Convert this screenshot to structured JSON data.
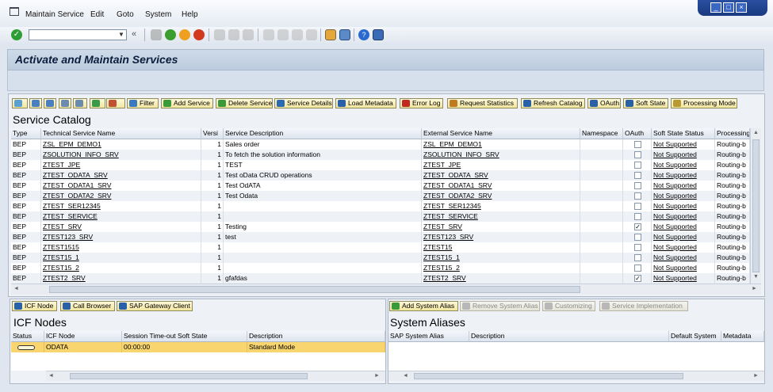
{
  "menubar": {
    "items": [
      "Maintain Service",
      "Edit",
      "Goto",
      "System",
      "Help"
    ]
  },
  "window_controls": {
    "minimize": "_",
    "restore": "□",
    "close": "×"
  },
  "toolbar": {
    "command_field": "",
    "back_icon": "«"
  },
  "page": {
    "title": "Activate and Maintain Services"
  },
  "catalog_toolbar": {
    "filter": "Filter",
    "add_service": "Add Service",
    "delete_service": "Delete Service",
    "service_details": "Service Details",
    "load_metadata": "Load Metadata",
    "error_log": "Error Log",
    "request_statistics": "Request Statistics",
    "refresh_catalog": "Refresh Catalog",
    "oauth": "OAuth",
    "soft_state": "Soft State",
    "processing_mode": "Processing Mode"
  },
  "catalog": {
    "title": "Service Catalog",
    "columns": [
      "Type",
      "Technical Service Name",
      "Versi",
      "Service Description",
      "External Service Name",
      "Namespace",
      "OAuth",
      "Soft State Status",
      "Processing"
    ],
    "rows": [
      {
        "type": "BEP",
        "tech": "ZSL_EPM_DEMO1",
        "ver": "1",
        "desc": "Sales order",
        "ext": "ZSL_EPM_DEMO1",
        "ns": "",
        "oauth": false,
        "soft": "Not Supported",
        "proc": "Routing-b"
      },
      {
        "type": "BEP",
        "tech": "ZSOLUTION_INFO_SRV",
        "ver": "1",
        "desc": "To fetch the solution information",
        "ext": "ZSOLUTION_INFO_SRV",
        "ns": "",
        "oauth": false,
        "soft": "Not Supported",
        "proc": "Routing-b"
      },
      {
        "type": "BEP",
        "tech": "ZTEST_JPE",
        "ver": "1",
        "desc": "TEST",
        "ext": "ZTEST_JPE",
        "ns": "",
        "oauth": false,
        "soft": "Not Supported",
        "proc": "Routing-b"
      },
      {
        "type": "BEP",
        "tech": "ZTEST_ODATA_SRV",
        "ver": "1",
        "desc": "Test oData CRUD operations",
        "ext": "ZTEST_ODATA_SRV",
        "ns": "",
        "oauth": false,
        "soft": "Not Supported",
        "proc": "Routing-b"
      },
      {
        "type": "BEP",
        "tech": "ZTEST_ODATA1_SRV",
        "ver": "1",
        "desc": "Test OdATA",
        "ext": "ZTEST_ODATA1_SRV",
        "ns": "",
        "oauth": false,
        "soft": "Not Supported",
        "proc": "Routing-b"
      },
      {
        "type": "BEP",
        "tech": "ZTEST_ODATA2_SRV",
        "ver": "1",
        "desc": "Test Odata",
        "ext": "ZTEST_ODATA2_SRV",
        "ns": "",
        "oauth": false,
        "soft": "Not Supported",
        "proc": "Routing-b"
      },
      {
        "type": "BEP",
        "tech": "ZTEST_SER12345",
        "ver": "1",
        "desc": "",
        "ext": "ZTEST_SER12345",
        "ns": "",
        "oauth": false,
        "soft": "Not Supported",
        "proc": "Routing-b"
      },
      {
        "type": "BEP",
        "tech": "ZTEST_SERVICE",
        "ver": "1",
        "desc": "",
        "ext": "ZTEST_SERVICE",
        "ns": "",
        "oauth": false,
        "soft": "Not Supported",
        "proc": "Routing-b"
      },
      {
        "type": "BEP",
        "tech": "ZTEST_SRV",
        "ver": "1",
        "desc": "Testing",
        "ext": "ZTEST_SRV",
        "ns": "",
        "oauth": true,
        "soft": "Not Supported",
        "proc": "Routing-b"
      },
      {
        "type": "BEP",
        "tech": "ZTEST123_SRV",
        "ver": "1",
        "desc": "test",
        "ext": "ZTEST123_SRV",
        "ns": "",
        "oauth": false,
        "soft": "Not Supported",
        "proc": "Routing-b"
      },
      {
        "type": "BEP",
        "tech": "ZTEST1515",
        "ver": "1",
        "desc": "",
        "ext": "ZTEST15",
        "ns": "",
        "oauth": false,
        "soft": "Not Supported",
        "proc": "Routing-b"
      },
      {
        "type": "BEP",
        "tech": "ZTEST15_1",
        "ver": "1",
        "desc": "",
        "ext": "ZTEST15_1",
        "ns": "",
        "oauth": false,
        "soft": "Not Supported",
        "proc": "Routing-b"
      },
      {
        "type": "BEP",
        "tech": "ZTEST15_2",
        "ver": "1",
        "desc": "",
        "ext": "ZTEST15_2",
        "ns": "",
        "oauth": false,
        "soft": "Not Supported",
        "proc": "Routing-b"
      },
      {
        "type": "BEP",
        "tech": "ZTEST2_SRV",
        "ver": "1",
        "desc": "gfafdas",
        "ext": "ZTEST2_SRV",
        "ns": "",
        "oauth": true,
        "soft": "Not Supported",
        "proc": "Routing-b"
      }
    ]
  },
  "icf_toolbar": {
    "icf_node": "ICF Node",
    "call_browser": "Call Browser",
    "gateway_client": "SAP Gateway Client"
  },
  "icf": {
    "title": "ICF Nodes",
    "columns": [
      "Status",
      "ICF Node",
      "Session Time-out Soft State",
      "Description"
    ],
    "rows": [
      {
        "status": "ooo",
        "node": "ODATA",
        "timeout": "00:00:00",
        "desc": "Standard Mode"
      }
    ]
  },
  "alias_toolbar": {
    "add": "Add System Alias",
    "remove": "Remove System Alias",
    "customizing": "Customizing",
    "impl": "Service Implementation"
  },
  "aliases": {
    "title": "System Aliases",
    "columns": [
      "SAP System Alias",
      "Description",
      "Default System",
      "Metadata"
    ]
  },
  "colors": {
    "selected_row": "#f8d56e",
    "button_yellow": "#f3e59e",
    "title_bg": "#c6d3e3"
  }
}
